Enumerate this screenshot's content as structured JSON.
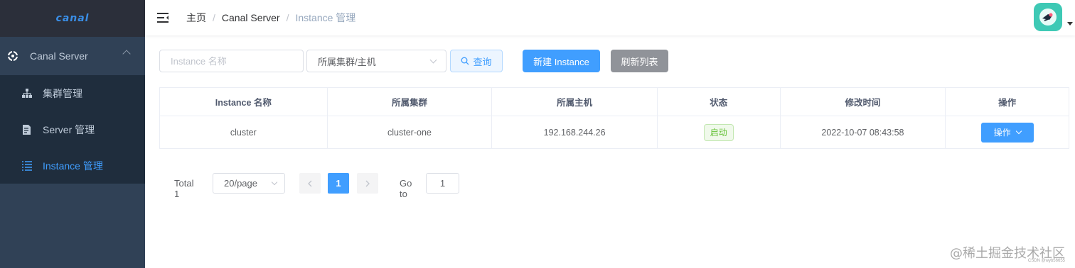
{
  "sidebar": {
    "logo": "canal",
    "menu_title": "Canal Server",
    "items": [
      {
        "label": "集群管理",
        "icon": "sitemap-icon"
      },
      {
        "label": "Server 管理",
        "icon": "document-icon"
      },
      {
        "label": "Instance 管理",
        "icon": "list-icon",
        "active": true
      }
    ]
  },
  "header": {
    "breadcrumb": [
      "主页",
      "Canal Server",
      "Instance 管理"
    ],
    "separator": "/"
  },
  "filters": {
    "name_placeholder": "Instance 名称",
    "cluster_select": "所属集群/主机",
    "query_label": "查询",
    "create_label": "新建 Instance",
    "refresh_label": "刷新列表"
  },
  "table": {
    "columns": [
      "Instance 名称",
      "所属集群",
      "所属主机",
      "状态",
      "修改时间",
      "操作"
    ],
    "rows": [
      {
        "name": "cluster",
        "cluster": "cluster-one",
        "host": "192.168.244.26",
        "status": "启动",
        "modified": "2022-10-07 08:43:58",
        "action": "操作"
      }
    ]
  },
  "pagination": {
    "total": "Total 1",
    "page_size": "20/page",
    "current_page": "1",
    "goto_label": "Go to",
    "goto_value": "1"
  },
  "watermark": {
    "text": "@稀土掘金技术社区",
    "sub": "CSDN @wyb56655"
  },
  "colors": {
    "sidebar_bg": "#304156",
    "submenu_bg": "#1f2d3d",
    "primary": "#409eff",
    "success": "#67c23a",
    "info": "#909399"
  }
}
